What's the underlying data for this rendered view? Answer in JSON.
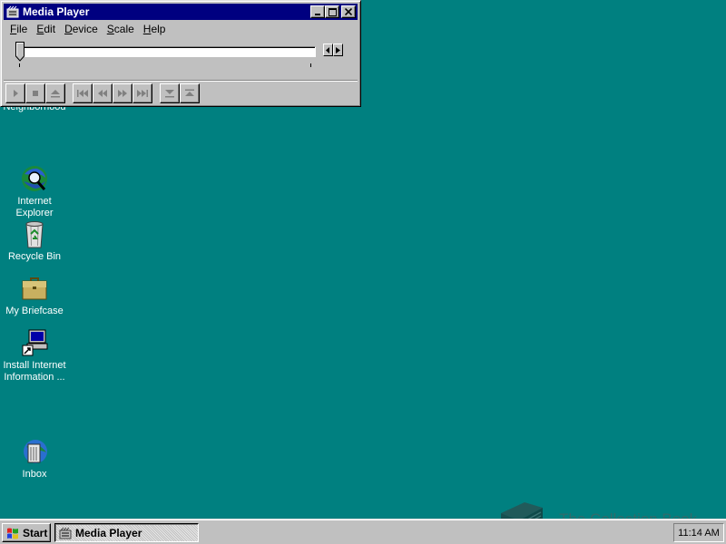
{
  "window": {
    "title": "Media Player",
    "menu": [
      {
        "label": "File",
        "mnemonic": "F",
        "rest": "ile"
      },
      {
        "label": "Edit",
        "mnemonic": "E",
        "rest": "dit"
      },
      {
        "label": "Device",
        "mnemonic": "D",
        "rest": "evice"
      },
      {
        "label": "Scale",
        "mnemonic": "S",
        "rest": "cale"
      },
      {
        "label": "Help",
        "mnemonic": "H",
        "rest": "elp"
      }
    ],
    "position": 0,
    "controls": [
      "play",
      "stop",
      "eject",
      "previous-mark",
      "rewind",
      "fast-forward",
      "next-mark",
      "start-selection",
      "end-selection"
    ]
  },
  "desktop_icons": [
    {
      "label_line1": "Neighborhood",
      "label_line2": "",
      "icon": "network-neighborhood-icon"
    },
    {
      "label_line1": "Internet",
      "label_line2": "Explorer",
      "icon": "internet-explorer-icon"
    },
    {
      "label_line1": "Recycle Bin",
      "label_line2": "",
      "icon": "recycle-bin-icon"
    },
    {
      "label_line1": "My Briefcase",
      "label_line2": "",
      "icon": "briefcase-icon"
    },
    {
      "label_line1": "Install Internet",
      "label_line2": "Information ...",
      "icon": "install-computer-icon"
    },
    {
      "label_line1": "Inbox",
      "label_line2": "",
      "icon": "inbox-icon"
    }
  ],
  "taskbar": {
    "start_label": "Start",
    "task_label": "Media Player",
    "clock": "11:14 AM"
  },
  "watermark": {
    "text": "The Collection Book"
  },
  "colors": {
    "desktop": "#008080",
    "titlebar": "#000080",
    "face": "#c0c0c0"
  }
}
